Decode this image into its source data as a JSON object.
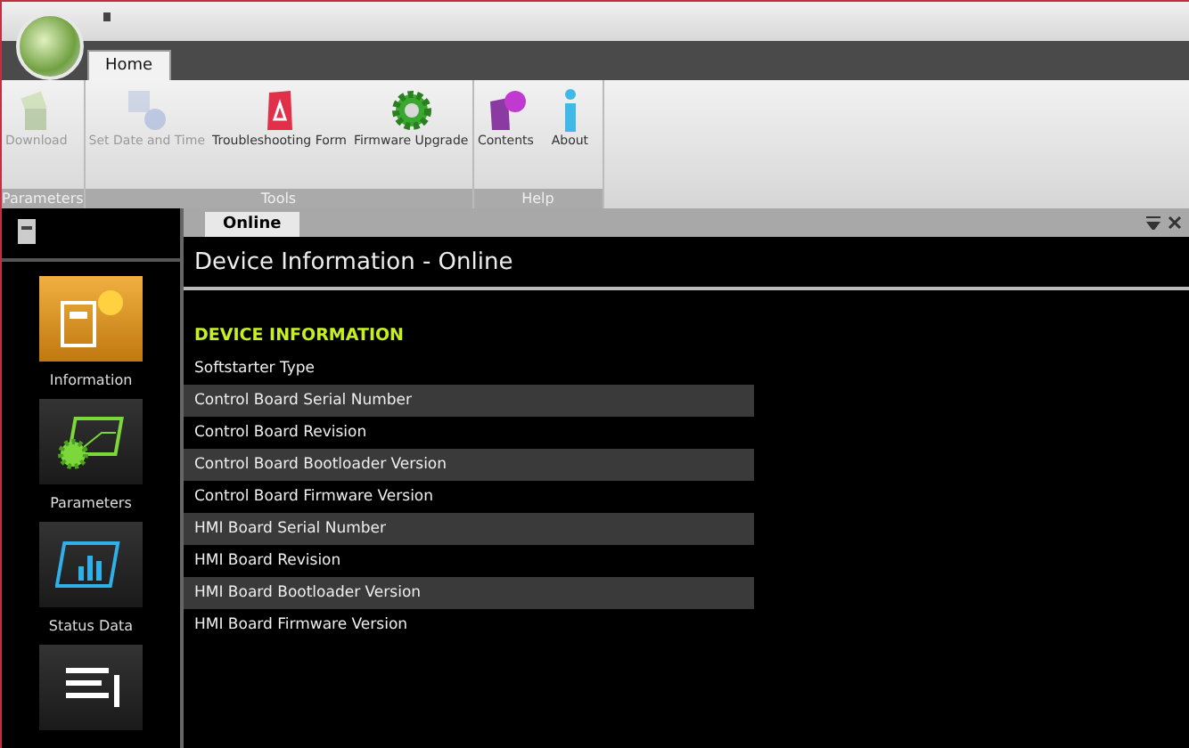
{
  "ribbon": {
    "tabs": [
      {
        "label": "Home",
        "selected": true
      }
    ],
    "groups": [
      {
        "label": "Parameters",
        "buttons": [
          {
            "label": "Download",
            "kind": "download",
            "disabled": true
          }
        ]
      },
      {
        "label": "Tools",
        "buttons": [
          {
            "label": "Set Date and Time",
            "kind": "clock",
            "disabled": true
          },
          {
            "label": "Troubleshooting Form",
            "kind": "form",
            "disabled": false
          },
          {
            "label": "Firmware Upgrade",
            "kind": "gear",
            "disabled": false
          }
        ]
      },
      {
        "label": "Help",
        "buttons": [
          {
            "label": "Contents",
            "kind": "book",
            "disabled": false
          },
          {
            "label": "About",
            "kind": "info",
            "disabled": false
          }
        ]
      }
    ]
  },
  "sidebar": {
    "items": [
      {
        "label": "Information",
        "kind": "info",
        "selected": true
      },
      {
        "label": "Parameters",
        "kind": "params",
        "selected": false
      },
      {
        "label": "Status Data",
        "kind": "chart",
        "selected": false
      },
      {
        "kind": "list",
        "selected": false
      }
    ]
  },
  "document": {
    "tab": "Online",
    "title": "Device Information - Online",
    "section": "DEVICE INFORMATION",
    "rows": [
      "Softstarter Type",
      "Control Board Serial Number",
      "Control Board Revision",
      "Control Board Bootloader Version",
      "Control Board Firmware Version",
      "HMI Board Serial Number",
      "HMI Board Revision",
      "HMI Board Bootloader Version",
      "HMI Board Firmware Version"
    ]
  }
}
